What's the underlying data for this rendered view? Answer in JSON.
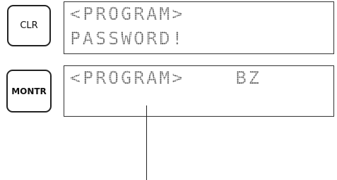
{
  "keys": {
    "clr": "CLR",
    "montr": "MONTR"
  },
  "display1": {
    "line1": "<PROGRAM>",
    "line2": "PASSWORD!"
  },
  "display2": {
    "line1": "<PROGRAM>    BZ",
    "line2": ""
  }
}
